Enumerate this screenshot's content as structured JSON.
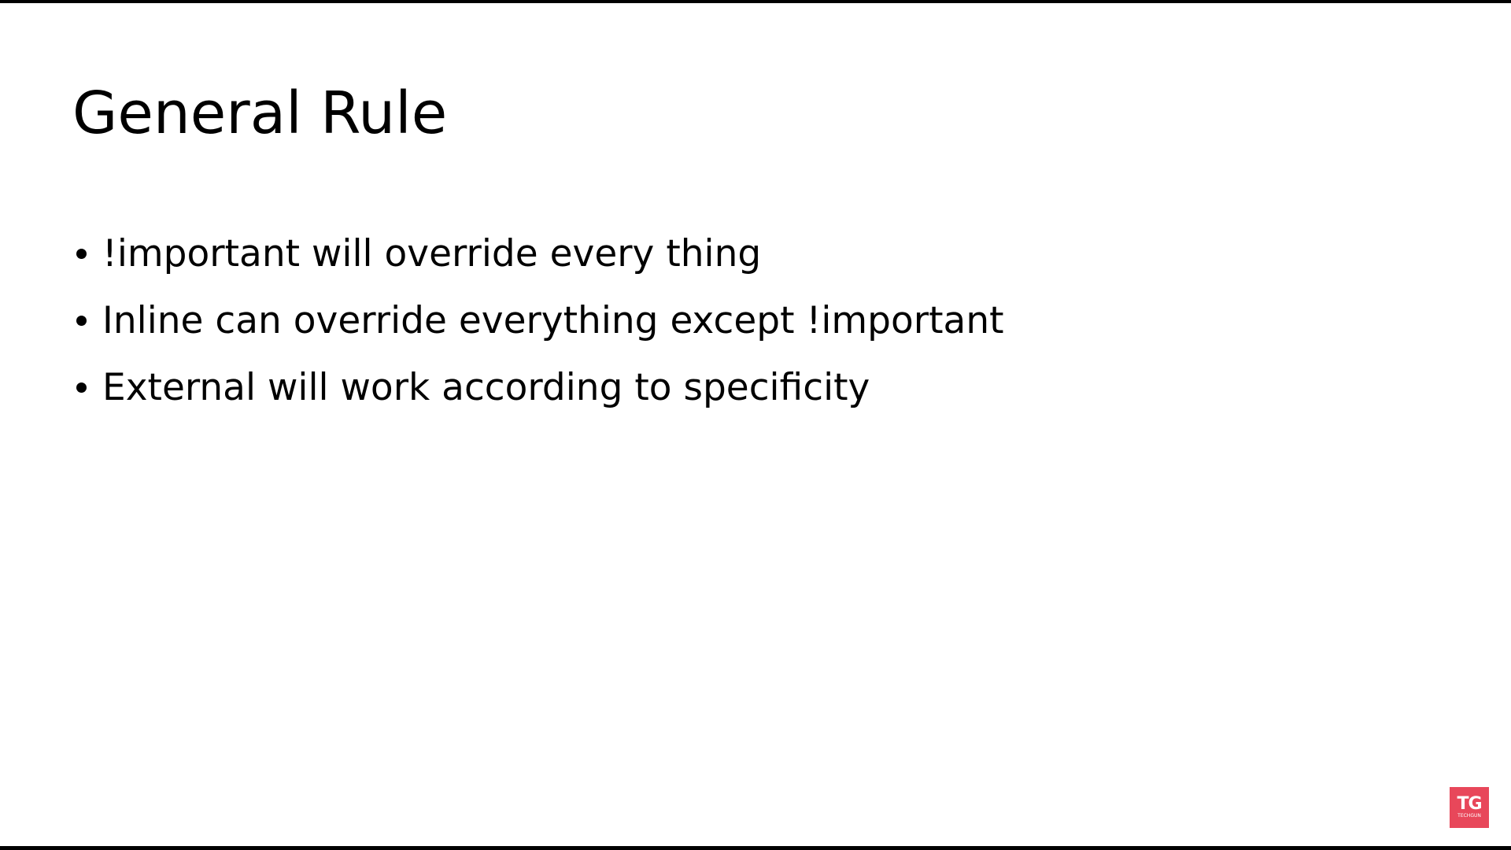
{
  "slide": {
    "title": "General Rule",
    "bullets": [
      {
        "text": "!important will override every thing"
      },
      {
        "text": "Inline can override everything except !important"
      },
      {
        "text": "External will work according to specificity"
      }
    ]
  },
  "logo": {
    "mark": "TG",
    "subtext": "TECHGUN",
    "color": "#e8475a"
  },
  "colors": {
    "background": "#ffffff",
    "text": "#000000",
    "frame": "#000000"
  }
}
